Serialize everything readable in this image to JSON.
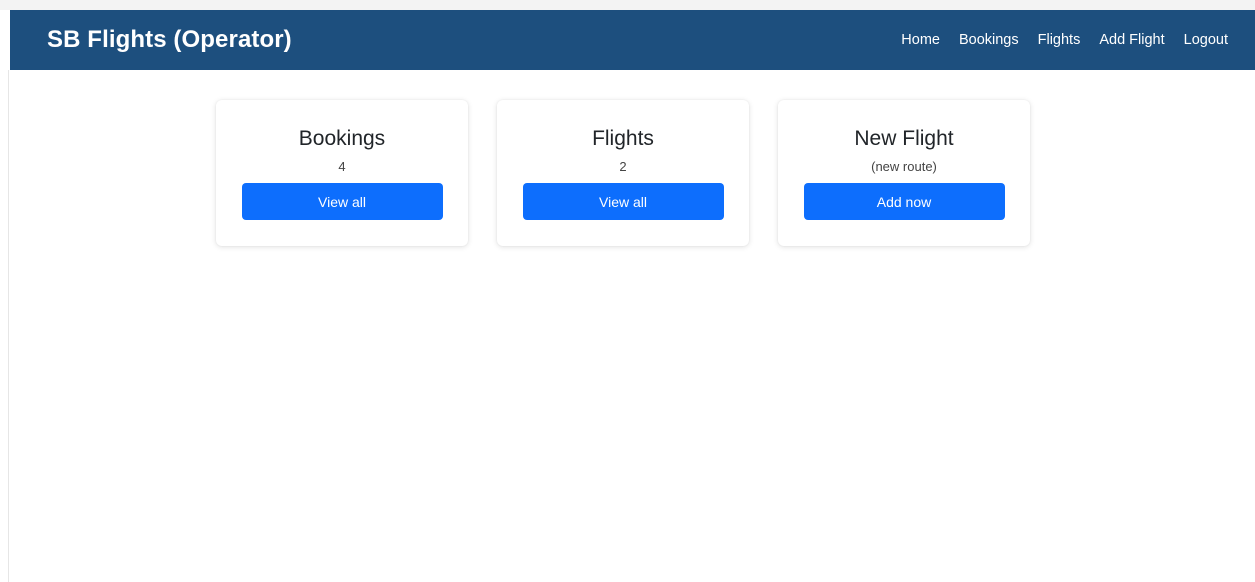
{
  "navbar": {
    "brand": "SB Flights (Operator)",
    "links": [
      "Home",
      "Bookings",
      "Flights",
      "Add Flight",
      "Logout"
    ]
  },
  "cards": [
    {
      "title": "Bookings",
      "subtitle": "4",
      "button": "View all"
    },
    {
      "title": "Flights",
      "subtitle": "2",
      "button": "View all"
    },
    {
      "title": "New Flight",
      "subtitle": "(new route)",
      "button": "Add now"
    }
  ],
  "colors": {
    "navbar_bg": "#1d4f7e",
    "button_bg": "#0d6efd"
  }
}
